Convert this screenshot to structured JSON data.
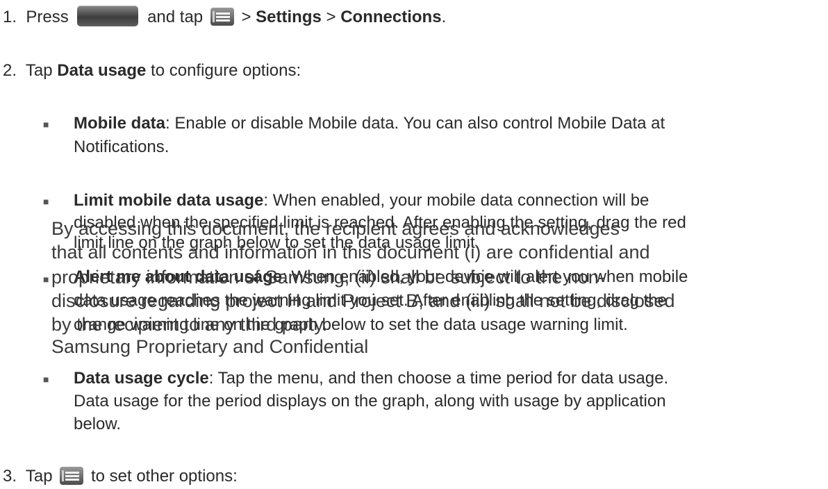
{
  "steps": [
    {
      "number": "1.",
      "press": "Press",
      "and_tap": "and tap",
      "sep1": ">",
      "settings": "Settings",
      "sep2": ">",
      "connections": "Connections",
      "end": "."
    },
    {
      "number": "2.",
      "tap": "Tap",
      "item": "Data usage",
      "rest": "to configure options:"
    },
    {
      "number": "3.",
      "tap": "Tap",
      "rest": "to set other options:"
    }
  ],
  "bullets": [
    {
      "term": "Mobile data",
      "lines": [
        ": Enable or disable Mobile data. You can also control Mobile Data at",
        "Notifications."
      ]
    },
    {
      "term": "Limit mobile data usage",
      "lines": [
        ": When enabled, your mobile data connection will be",
        "disabled when the specified limit is reached. After enabling the setting, drag the red",
        "limit line on the graph below to set the data usage limit."
      ]
    },
    {
      "term": "Alert me about data usage",
      "lines": [
        ": When enabled, your device will alert you when mobile",
        "data usage reaches the warning limit you set. After enabling the setting, drag the",
        "orange warning line on the graph below to set the data usage warning limit."
      ]
    },
    {
      "term": "Data usage cycle",
      "lines": [
        ": Tap the menu, and then choose a time period for data usage.",
        "Data usage for the period displays on the graph, along with usage by application",
        "below."
      ]
    }
  ],
  "watermark": [
    "By accessing this document, the recipient agrees and acknowledges",
    "that all contents and information in this document (i) are confidential and",
    "proprietary information of Samsung, (ii) shall be subject to the non-",
    "disclosure regarding project H and Project B, and (iii) shall not be disclosed",
    "by the recipient to any third party.",
    "Samsung Proprietary and Confidential"
  ],
  "icons": {
    "key": "home-key-icon",
    "menu": "menu-key-icon"
  }
}
